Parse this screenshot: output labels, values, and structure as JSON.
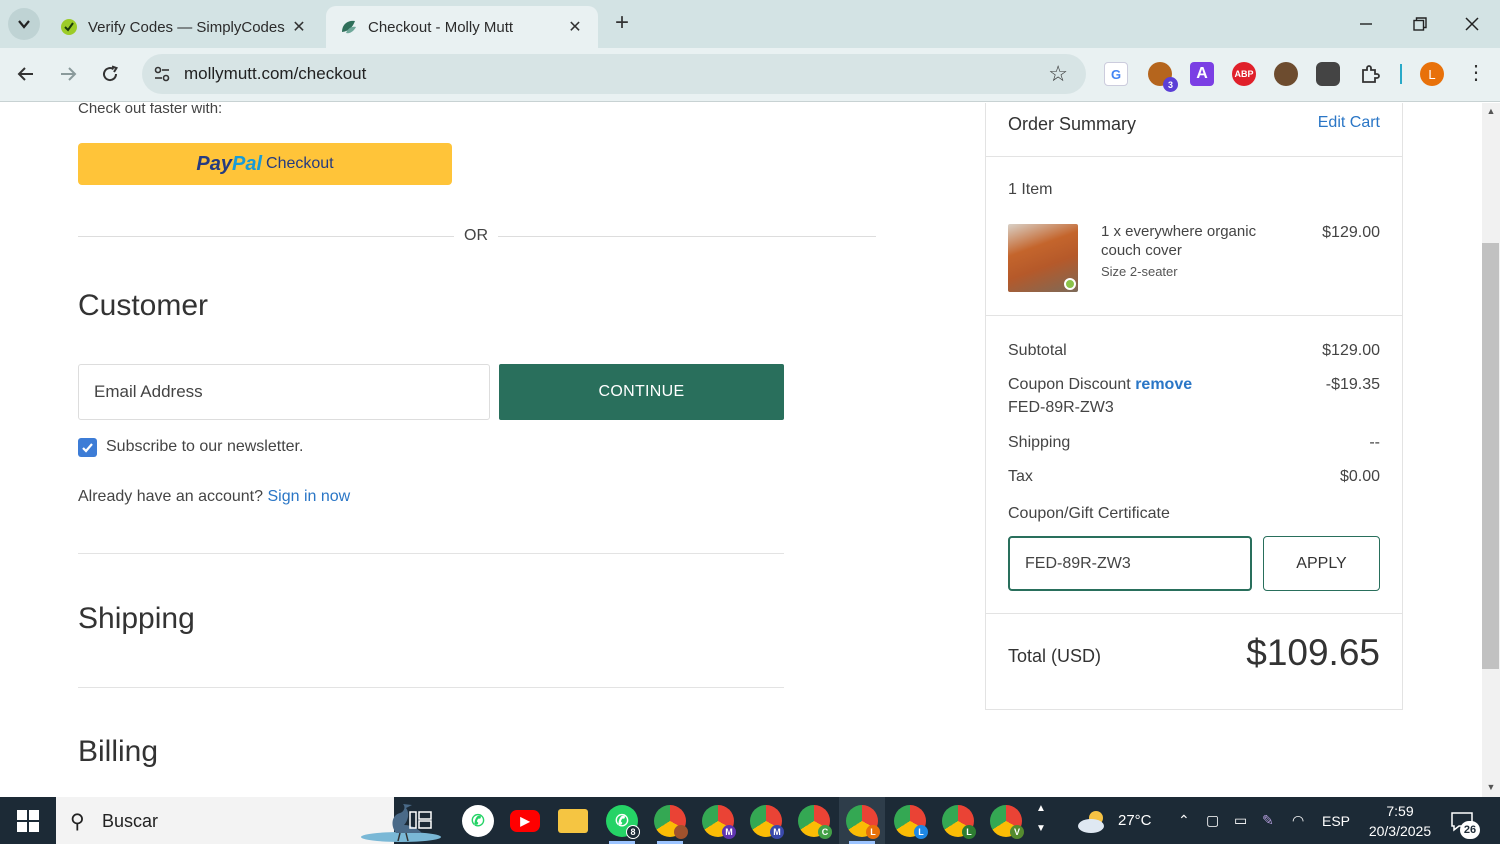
{
  "browser": {
    "tabs": [
      {
        "title": "Verify Codes — SimplyCodes",
        "active": false
      },
      {
        "title": "Checkout - Molly Mutt",
        "active": true
      }
    ],
    "url": "mollymutt.com/checkout",
    "extension_badge": "3",
    "profile_initial": "L"
  },
  "checkout": {
    "faster_label": "Check out faster with:",
    "paypal": {
      "pay": "Pay",
      "pal": "Pal",
      "checkout": "Checkout"
    },
    "or_label": "OR",
    "customer_heading": "Customer",
    "email_placeholder": "Email Address",
    "continue_label": "CONTINUE",
    "newsletter_label": "Subscribe to our newsletter.",
    "newsletter_checked": true,
    "account_prompt": "Already have an account?",
    "sign_in_label": "Sign in now",
    "shipping_heading": "Shipping",
    "billing_heading": "Billing"
  },
  "summary": {
    "title": "Order Summary",
    "edit_cart": "Edit Cart",
    "item_count": "1 Item",
    "item": {
      "name": "1 x everywhere organic couch cover",
      "size": "Size 2-seater",
      "price": "$129.00"
    },
    "subtotal_label": "Subtotal",
    "subtotal_value": "$129.00",
    "coupon_label": "Coupon Discount",
    "coupon_remove": "remove",
    "coupon_code": "FED-89R-ZW3",
    "coupon_value": "-$19.35",
    "shipping_label": "Shipping",
    "shipping_value": "--",
    "tax_label": "Tax",
    "tax_value": "$0.00",
    "gift_label": "Coupon/Gift Certificate",
    "gift_input_value": "FED-89R-ZW3",
    "apply_label": "APPLY",
    "total_label": "Total (USD)",
    "total_value": "$109.65"
  },
  "taskbar": {
    "search_placeholder": "Buscar",
    "whatsapp_badge": "8",
    "weather": "27°C",
    "language": "ESP",
    "time": "7:59",
    "date": "20/3/2025",
    "notifications": "26"
  },
  "colors": {
    "accent_green": "#296f5c",
    "link_blue": "#2a76c6",
    "paypal_yellow": "#ffc439",
    "taskbar": "#1c2a36"
  }
}
